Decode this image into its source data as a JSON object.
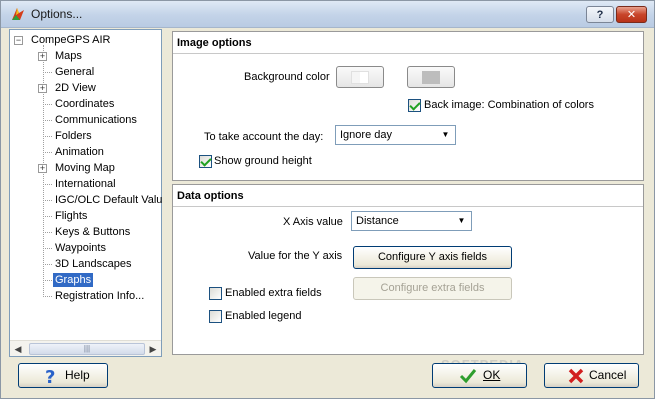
{
  "window": {
    "title": "Options...",
    "help_button": "?",
    "close_button": "✕"
  },
  "tree": {
    "items": [
      {
        "label": "CompeGPS AIR",
        "level": 0,
        "expander": "−"
      },
      {
        "label": "Maps",
        "level": 1,
        "expander": "+"
      },
      {
        "label": "General",
        "level": 1,
        "expander": ""
      },
      {
        "label": "2D View",
        "level": 1,
        "expander": "+"
      },
      {
        "label": "Coordinates",
        "level": 1,
        "expander": ""
      },
      {
        "label": "Communications",
        "level": 1,
        "expander": ""
      },
      {
        "label": "Folders",
        "level": 1,
        "expander": ""
      },
      {
        "label": "Animation",
        "level": 1,
        "expander": ""
      },
      {
        "label": "Moving Map",
        "level": 1,
        "expander": "+"
      },
      {
        "label": "International",
        "level": 1,
        "expander": ""
      },
      {
        "label": "IGC/OLC Default Valu",
        "level": 1,
        "expander": ""
      },
      {
        "label": "Flights",
        "level": 1,
        "expander": ""
      },
      {
        "label": "Keys & Buttons",
        "level": 1,
        "expander": ""
      },
      {
        "label": "Waypoints",
        "level": 1,
        "expander": ""
      },
      {
        "label": "3D Landscapes",
        "level": 1,
        "expander": ""
      },
      {
        "label": "Graphs",
        "level": 1,
        "expander": "",
        "selected": true
      },
      {
        "label": "Registration Info...",
        "level": 1,
        "expander": ""
      }
    ],
    "scroll_left": "◀",
    "scroll_right": "▶",
    "scroll_grip": "|||"
  },
  "image_options": {
    "title": "Image options",
    "background_color_label": "Background color",
    "back_image_label": "Back image: Combination of colors",
    "back_image_checked": true,
    "take_account_label": "To take account the day:",
    "take_account_value": "Ignore day",
    "show_ground_label": "Show ground height",
    "show_ground_checked": true
  },
  "data_options": {
    "title": "Data options",
    "x_axis_label": "X Axis value",
    "x_axis_value": "Distance",
    "y_axis_label": "Value for the Y axis",
    "configure_y_button": "Configure Y axis fields",
    "extra_fields_label": "Enabled extra fields",
    "extra_fields_checked": false,
    "configure_extra_button": "Configure extra fields",
    "legend_label": "Enabled legend",
    "legend_checked": false
  },
  "footer": {
    "help_label": "Help",
    "ok_label": "OK",
    "cancel_label": "Cancel",
    "watermark": "SOFTPEDIA"
  },
  "colors": {
    "selection": "#316ac5",
    "ok_icon": "#2e9e2e",
    "cancel_icon": "#d21f1f",
    "help_icon": "#2a62c9"
  }
}
